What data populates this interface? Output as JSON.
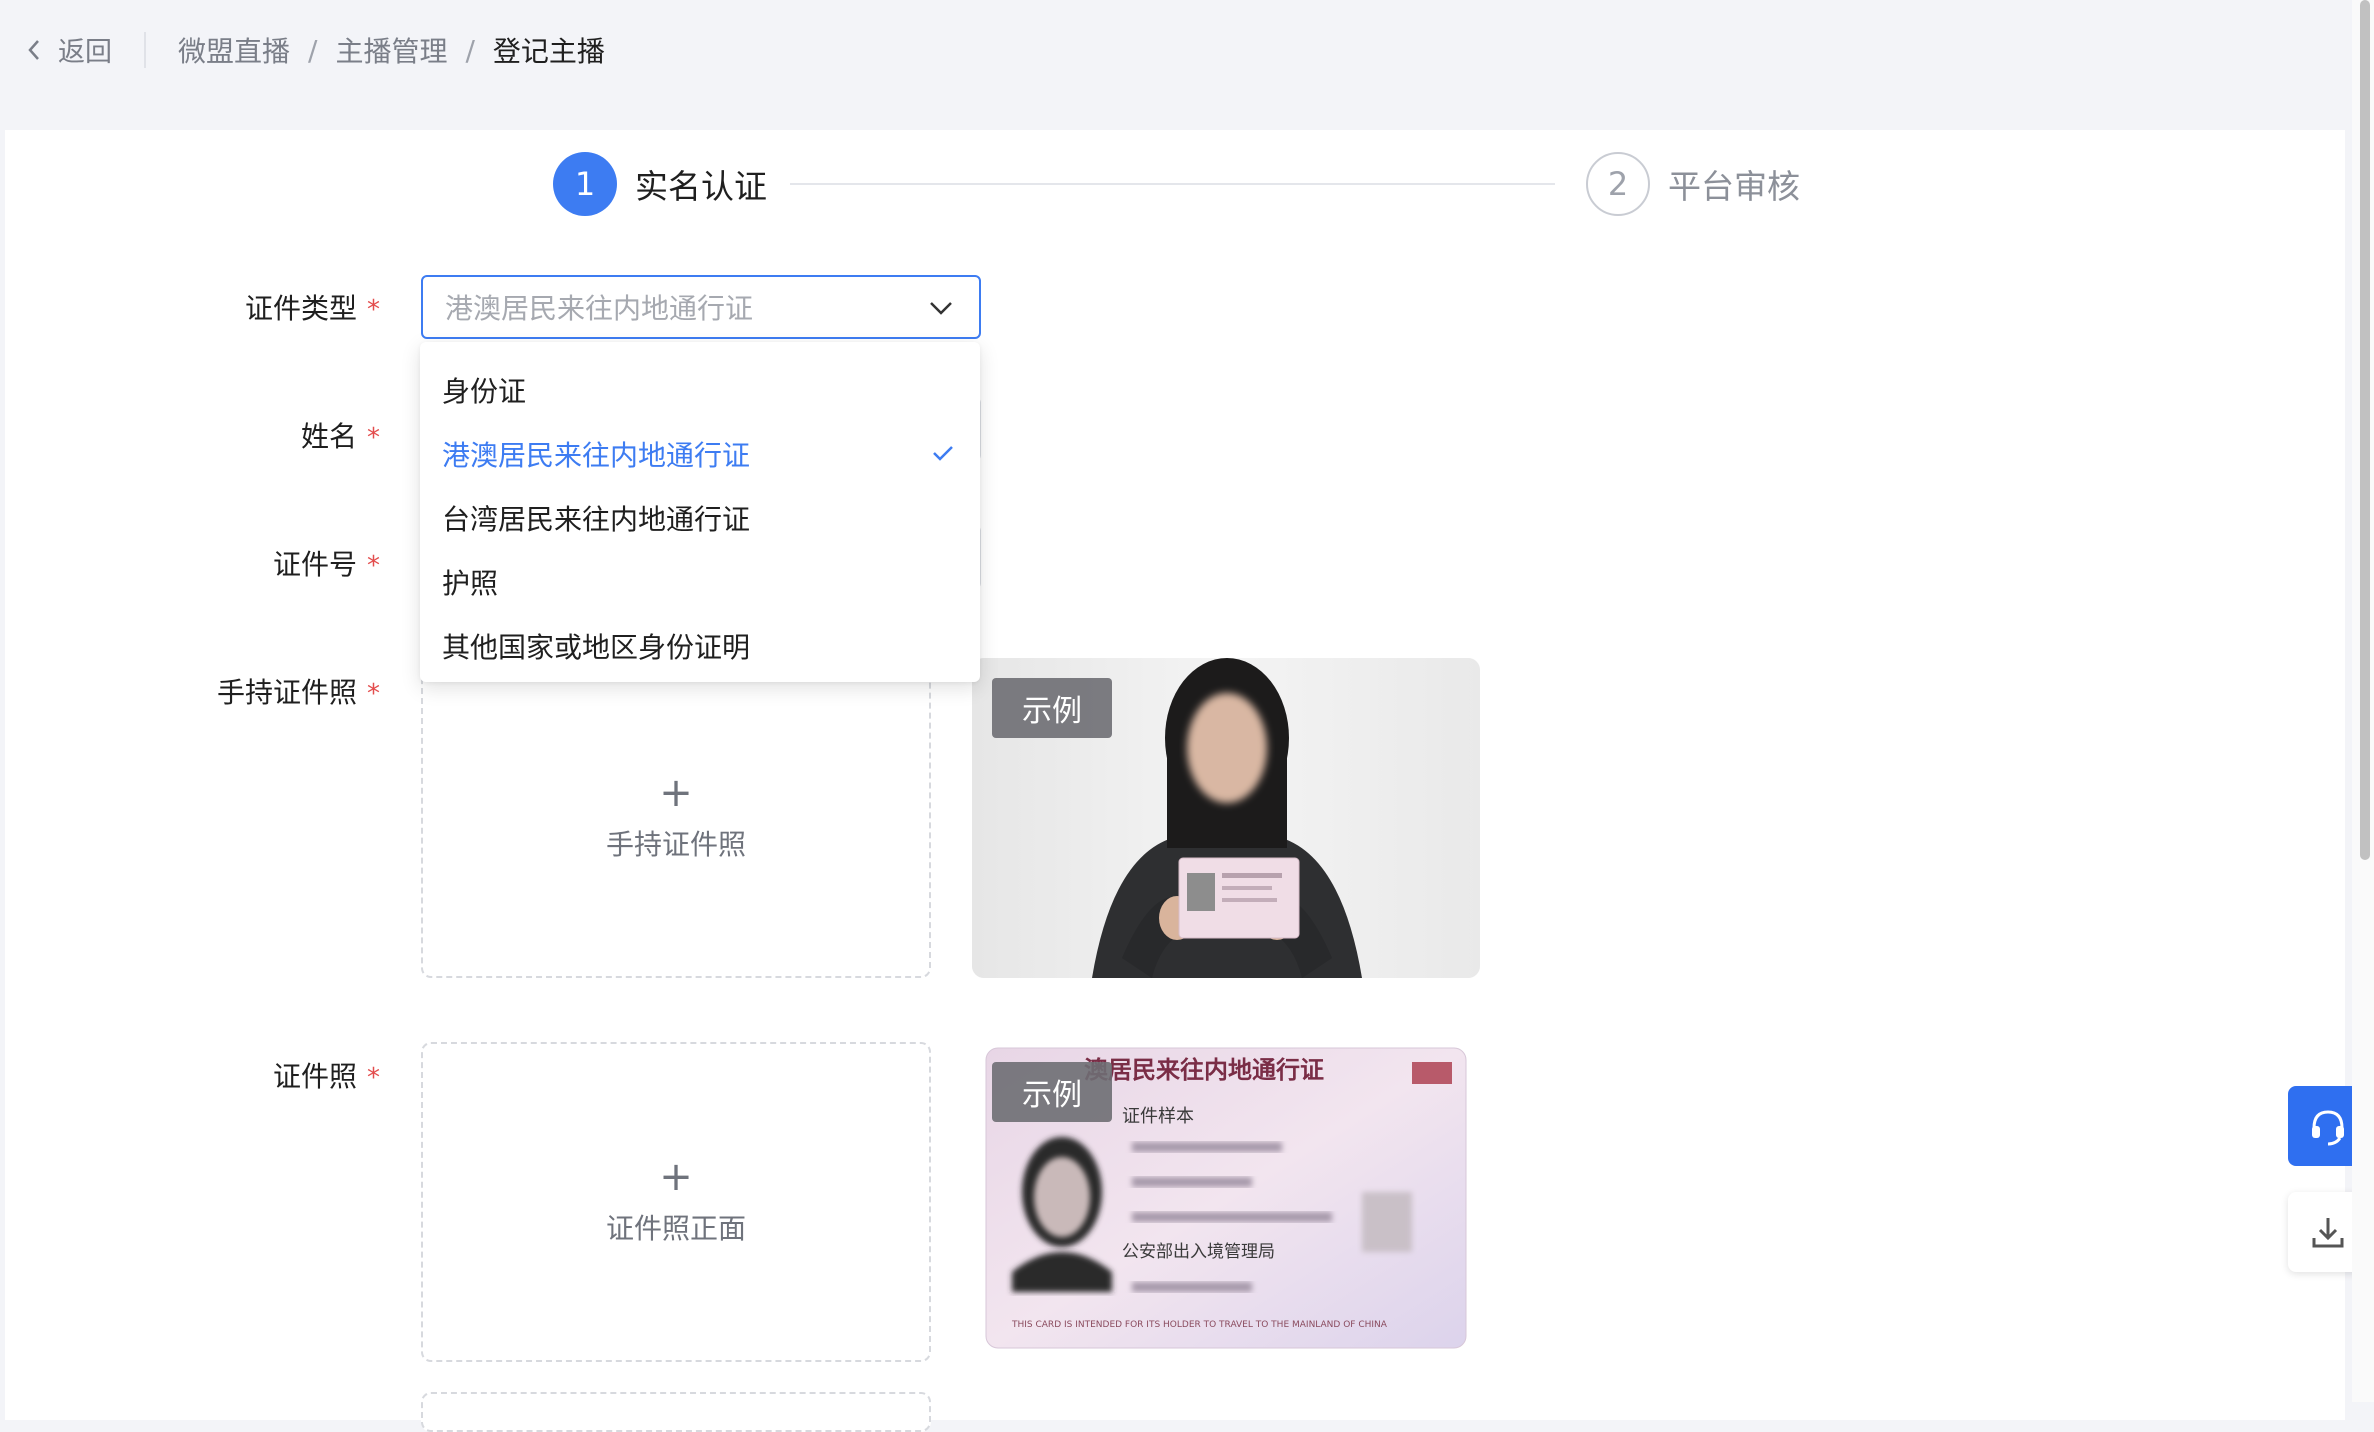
{
  "header": {
    "back_label": "返回",
    "breadcrumbs": [
      "微盟直播",
      "主播管理",
      "登记主播"
    ],
    "separator": "/"
  },
  "steps": [
    {
      "number": "1",
      "label": "实名认证",
      "state": "active"
    },
    {
      "number": "2",
      "label": "平台审核",
      "state": "pending"
    }
  ],
  "form": {
    "id_type": {
      "label": "证件类型",
      "required_mark": "*",
      "selected_value": "港澳居民来往内地通行证",
      "options": [
        {
          "label": "身份证",
          "selected": false
        },
        {
          "label": "港澳居民来往内地通行证",
          "selected": true
        },
        {
          "label": "台湾居民来往内地通行证",
          "selected": false
        },
        {
          "label": "护照",
          "selected": false
        },
        {
          "label": "其他国家或地区身份证明",
          "selected": false
        }
      ]
    },
    "name": {
      "label": "姓名",
      "required_mark": "*"
    },
    "id_number": {
      "label": "证件号",
      "required_mark": "*"
    },
    "handheld_photo": {
      "label": "手持证件照",
      "required_mark": "*",
      "upload_text": "手持证件照",
      "plus": "+",
      "example_badge": "示例"
    },
    "id_photo": {
      "label": "证件照",
      "required_mark": "*",
      "upload_text": "证件照正面",
      "plus": "+",
      "example_badge": "示例",
      "card_title": "澳居民来往内地通行证",
      "card_subtitle": "证件样本",
      "card_authority": "公安部出入境管理局",
      "card_footer": "THIS CARD IS INTENDED FOR ITS HOLDER TO TRAVEL TO THE MAINLAND OF CHINA"
    }
  },
  "colors": {
    "primary": "#3d7cf2",
    "required": "#e34d4d",
    "float_service": "#2f6ff0"
  },
  "icons": {
    "back": "chevron-left-icon",
    "select": "chevron-down-icon",
    "check": "check-icon",
    "service": "headset-icon",
    "download": "download-icon"
  }
}
